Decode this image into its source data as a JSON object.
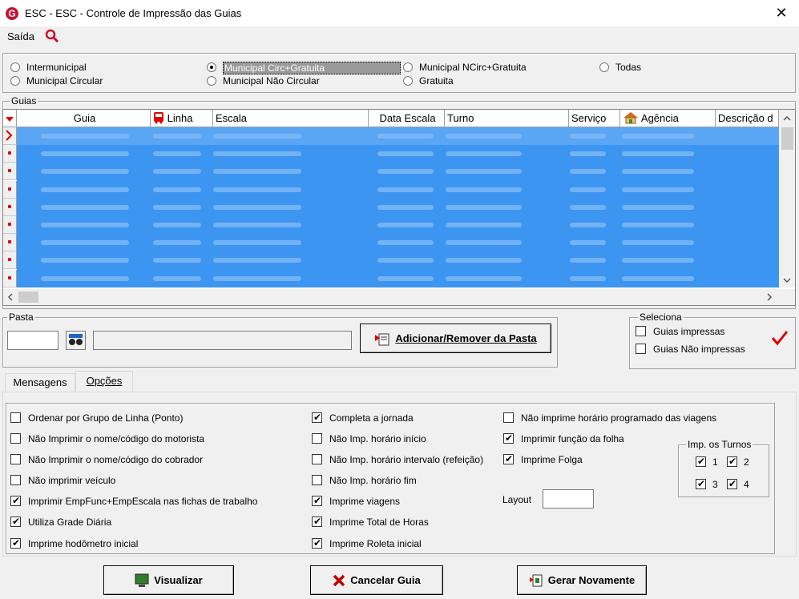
{
  "window": {
    "app_code": "ESC -",
    "title": "ESC - Controle de Impressão das Guias",
    "close_glyph": "✕",
    "logo_letter": "G"
  },
  "menu": {
    "saida": "Saída"
  },
  "filter_options": [
    {
      "label": "Intermunicipal",
      "selected": false
    },
    {
      "label": "Municipal Circular",
      "selected": false
    },
    {
      "label": "Municipal Circ+Gratuita",
      "selected": true
    },
    {
      "label": "Municipal Não Circular",
      "selected": false
    },
    {
      "label": "Municipal NCirc+Gratuita",
      "selected": false
    },
    {
      "label": "Gratuita",
      "selected": false
    },
    {
      "label": "Todas",
      "selected": false
    }
  ],
  "guias": {
    "legend": "Guias",
    "columns": [
      "Guia",
      "Linha",
      "Escala",
      "Data Escala",
      "Turno",
      "Serviço",
      "Agência",
      "Descrição d"
    ],
    "row_count": 9
  },
  "pasta": {
    "legend": "Pasta",
    "code_value": "",
    "name_value": "",
    "add_button": "Adicionar/Remover da Pasta"
  },
  "seleciona": {
    "legend": "Seleciona",
    "items": [
      {
        "label": "Guias impressas",
        "checked": false
      },
      {
        "label": "Guias Não impressas",
        "checked": false
      }
    ]
  },
  "tabs": [
    {
      "label": "Mensagens",
      "active": false
    },
    {
      "label": "Opções",
      "active": true
    }
  ],
  "options": {
    "col1": [
      {
        "label": "Ordenar por Grupo de Linha (Ponto)",
        "checked": false
      },
      {
        "label": "Não Imprimir o nome/código do motorista",
        "checked": false
      },
      {
        "label": "Não Imprimir o nome/código do cobrador",
        "checked": false
      },
      {
        "label": "Não imprimir veículo",
        "checked": false
      },
      {
        "label": "Imprimir EmpFunc+EmpEscala nas fichas de trabalho",
        "checked": true
      },
      {
        "label": "Utiliza Grade Diária",
        "checked": true
      },
      {
        "label": "Imprime hodômetro inicial",
        "checked": true
      }
    ],
    "col2": [
      {
        "label": "Completa a jornada",
        "checked": true
      },
      {
        "label": "Não Imp. horário início",
        "checked": false
      },
      {
        "label": "Não Imp. horário intervalo (refeição)",
        "checked": false
      },
      {
        "label": "Não Imp. horário fim",
        "checked": false
      },
      {
        "label": "Imprime viagens",
        "checked": true
      },
      {
        "label": "Imprime Total de Horas",
        "checked": true
      },
      {
        "label": "Imprime Roleta inicial",
        "checked": true
      }
    ],
    "col3": [
      {
        "label": "Não imprime horário programado das viagens",
        "checked": false
      },
      {
        "label": "Imprimir função da folha",
        "checked": true
      },
      {
        "label": "Imprime Folga",
        "checked": true
      }
    ],
    "layout_label": "Layout",
    "layout_value": "",
    "turnos": {
      "legend": "Imp. os Turnos",
      "items": [
        {
          "label": "1",
          "checked": true
        },
        {
          "label": "2",
          "checked": true
        },
        {
          "label": "3",
          "checked": true
        },
        {
          "label": "4",
          "checked": true
        }
      ]
    }
  },
  "buttons": {
    "visualizar": "Visualizar",
    "cancelar": "Cancelar Guia",
    "gerar": "Gerar Novamente"
  },
  "colors": {
    "selection": "#3d95f2",
    "accent_red": "#c8102e"
  }
}
